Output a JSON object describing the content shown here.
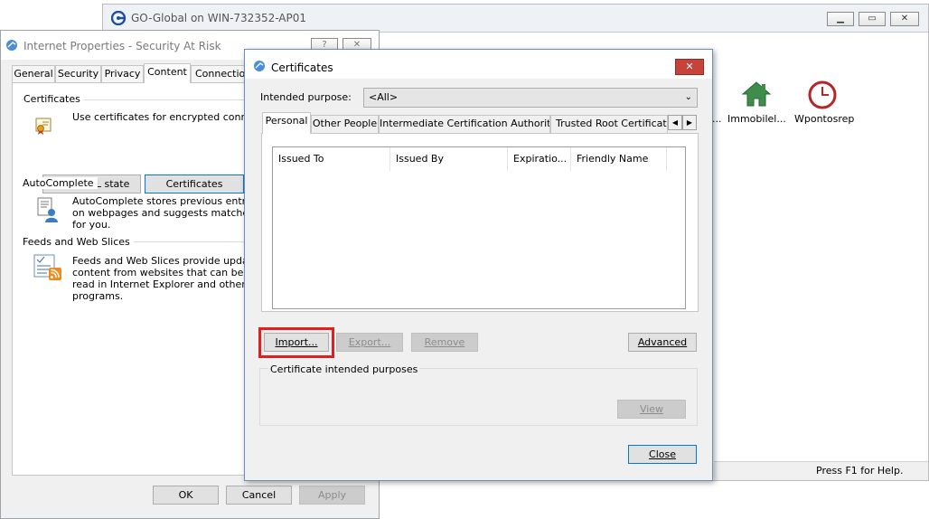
{
  "goglobal": {
    "title": "GO-Global on WIN-732352-AP01",
    "status": "Press F1 for Help.",
    "icons": [
      {
        "label": "...",
        "icon": "truncated-icon"
      },
      {
        "label": "Immobilel...",
        "icon": "house-icon"
      },
      {
        "label": "Wpontosrep",
        "icon": "clock-icon"
      }
    ]
  },
  "inetprops": {
    "title": "Internet Properties - Security At Risk",
    "help_label": "?",
    "close_label": "✕",
    "tabs": [
      "General",
      "Security",
      "Privacy",
      "Content",
      "Connection"
    ],
    "certificates_group": "Certificates",
    "certificates_desc": "Use certificates for encrypted connectio",
    "clear_ssl_label": "Clear SSL state",
    "certificates_button": "Certificates",
    "autocomplete_group": "AutoComplete",
    "autocomplete_desc_1": "AutoComplete stores previous entries",
    "autocomplete_desc_2": "on webpages and suggests matches",
    "autocomplete_desc_3": "for you.",
    "feeds_group": "Feeds and Web Slices",
    "feeds_desc_1": "Feeds and Web Slices provide updated",
    "feeds_desc_2": "content from websites that can be",
    "feeds_desc_3": "read in Internet Explorer and other",
    "feeds_desc_4": "programs.",
    "ok_label": "OK",
    "cancel_label": "Cancel",
    "apply_label": "Apply"
  },
  "certs": {
    "title": "Certificates",
    "close_label": "✕",
    "intended_purpose_label": "Intended purpose:",
    "intended_purpose_value": "<All>",
    "tabs": [
      "Personal",
      "Other People",
      "Intermediate Certification Authorities",
      "Trusted Root Certification"
    ],
    "columns": [
      "Issued To",
      "Issued By",
      "Expiratio...",
      "Friendly Name"
    ],
    "import_label": "Import...",
    "export_label": "Export...",
    "remove_label": "Remove",
    "advanced_label": "Advanced",
    "purposes_group": "Certificate intended purposes",
    "view_label": "View",
    "close_button": "Close"
  }
}
